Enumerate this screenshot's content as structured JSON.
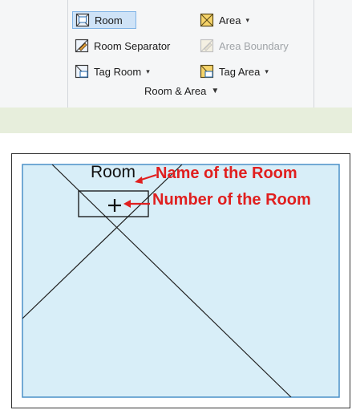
{
  "ribbon": {
    "buttons": {
      "room": "Room",
      "area": "Area",
      "room_separator": "Room  Separator",
      "area_boundary": "Area Boundary",
      "tag_room": "Tag Room",
      "tag_area": "Tag Area"
    },
    "panel_title": "Room & Area",
    "colors": {
      "selected_bg": "#cfe3f7",
      "selected_border": "#80b4e6",
      "status_band": "#e7eedc"
    }
  },
  "drawing": {
    "room_name": "Room",
    "annotations": {
      "name": "Name of the Room",
      "number": "Number of the Room"
    },
    "colors": {
      "room_fill": "#d8eef8",
      "room_border": "#4a90c8",
      "annotation": "#e01f1f"
    }
  }
}
